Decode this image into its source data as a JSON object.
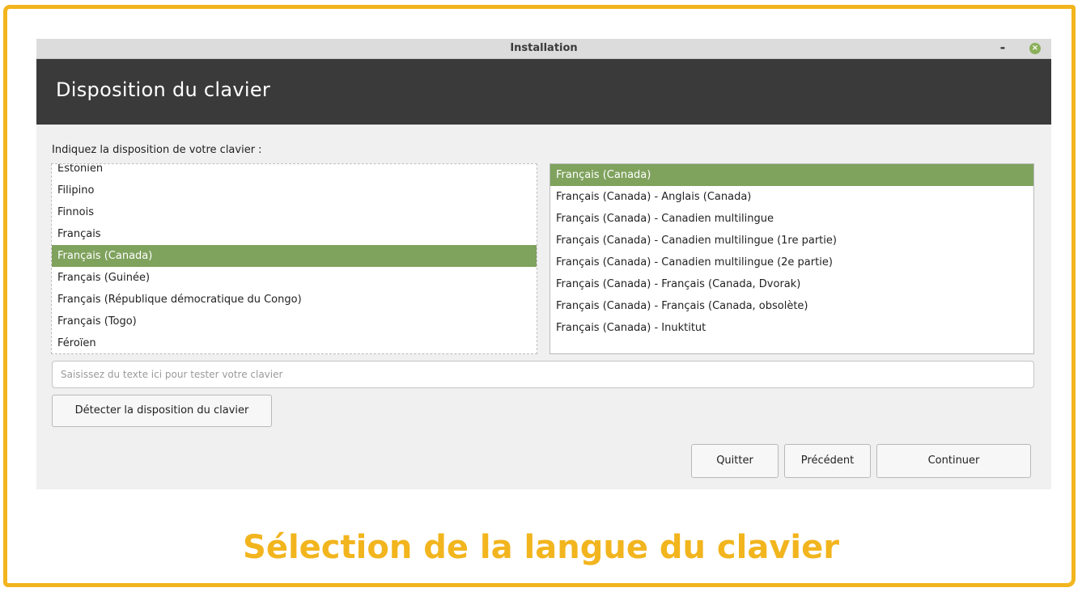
{
  "window": {
    "title": "Installation",
    "minimize_label": "-",
    "close_label": "×"
  },
  "header": {
    "title": "Disposition du clavier"
  },
  "prompt": "Indiquez la disposition de votre clavier :",
  "layouts": [
    {
      "label": "Estonien",
      "selected": false
    },
    {
      "label": "Filipino",
      "selected": false
    },
    {
      "label": "Finnois",
      "selected": false
    },
    {
      "label": "Français",
      "selected": false
    },
    {
      "label": "Français (Canada)",
      "selected": true
    },
    {
      "label": "Français (Guinée)",
      "selected": false
    },
    {
      "label": "Français (République démocratique du Congo)",
      "selected": false
    },
    {
      "label": "Français (Togo)",
      "selected": false
    },
    {
      "label": "Féroïen",
      "selected": false
    }
  ],
  "variants": [
    {
      "label": "Français (Canada)",
      "selected": true
    },
    {
      "label": "Français (Canada) - Anglais (Canada)",
      "selected": false
    },
    {
      "label": "Français (Canada) - Canadien multilingue",
      "selected": false
    },
    {
      "label": "Français (Canada) - Canadien multilingue (1re partie)",
      "selected": false
    },
    {
      "label": "Français (Canada) - Canadien multilingue (2e partie)",
      "selected": false
    },
    {
      "label": "Français (Canada) - Français (Canada, Dvorak)",
      "selected": false
    },
    {
      "label": "Français (Canada) - Français (Canada, obsolète)",
      "selected": false
    },
    {
      "label": "Français (Canada) - Inuktitut",
      "selected": false
    }
  ],
  "test_input": {
    "value": "",
    "placeholder": "Saisissez du texte ici pour tester votre clavier"
  },
  "buttons": {
    "detect": "Détecter la disposition du clavier",
    "quit": "Quitter",
    "previous": "Précédent",
    "continue": "Continuer"
  },
  "caption": "Sélection de la langue du clavier",
  "colors": {
    "accent_frame": "#f2b51e",
    "selection": "#7fa25d",
    "header": "#3a3a3a",
    "close_button": "#8bb05a"
  }
}
